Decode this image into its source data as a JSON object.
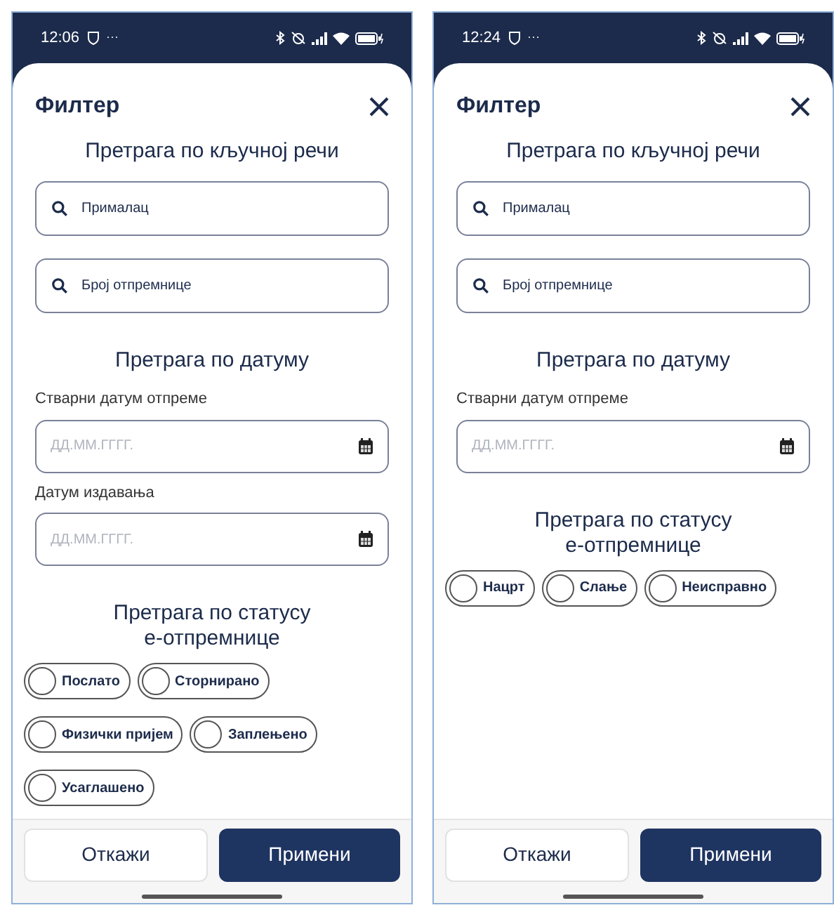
{
  "phones": [
    {
      "status_bar": {
        "time": "12:06",
        "more": "···"
      },
      "title": "Филтер",
      "keyword_section": {
        "heading": "Претрага по кључној речи",
        "fields": [
          {
            "placeholder": "Прималац"
          },
          {
            "placeholder": "Број отпремнице"
          }
        ]
      },
      "date_section": {
        "heading": "Претрага по датуму",
        "fields": [
          {
            "label": "Стварни датум отпреме",
            "placeholder": "ДД.ММ.ГГГГ."
          },
          {
            "label": "Датум издавања",
            "placeholder": "ДД.ММ.ГГГГ."
          }
        ]
      },
      "status_section": {
        "heading": "Претрага по статусу е-отпремнице",
        "options": [
          {
            "label": "Послато",
            "selected": false
          },
          {
            "label": "Сторнирано",
            "selected": false
          },
          {
            "label": "Физички пријем",
            "selected": false
          },
          {
            "label": "Заплењено",
            "selected": false
          },
          {
            "label": "Усаглашено",
            "selected": false
          }
        ]
      },
      "buttons": [
        {
          "label": "Откажи",
          "kind": "secondary"
        },
        {
          "label": "Примени",
          "kind": "primary"
        }
      ]
    },
    {
      "status_bar": {
        "time": "12:24",
        "more": "···"
      },
      "title": "Филтер",
      "keyword_section": {
        "heading": "Претрага по кључној речи",
        "fields": [
          {
            "placeholder": "Прималац"
          },
          {
            "placeholder": "Број отпремнице"
          }
        ]
      },
      "date_section": {
        "heading": "Претрага по датуму",
        "fields": [
          {
            "label": "Стварни датум отпреме",
            "placeholder": "ДД.ММ.ГГГГ."
          }
        ]
      },
      "status_section": {
        "heading": "Претрага по статусу е-отпремнице",
        "options": [
          {
            "label": "Нацрт",
            "selected": false
          },
          {
            "label": "Слање",
            "selected": false
          },
          {
            "label": "Неисправно",
            "selected": false
          }
        ]
      },
      "buttons": [
        {
          "label": "Откажи",
          "kind": "secondary"
        },
        {
          "label": "Примени",
          "kind": "primary"
        }
      ]
    }
  ]
}
